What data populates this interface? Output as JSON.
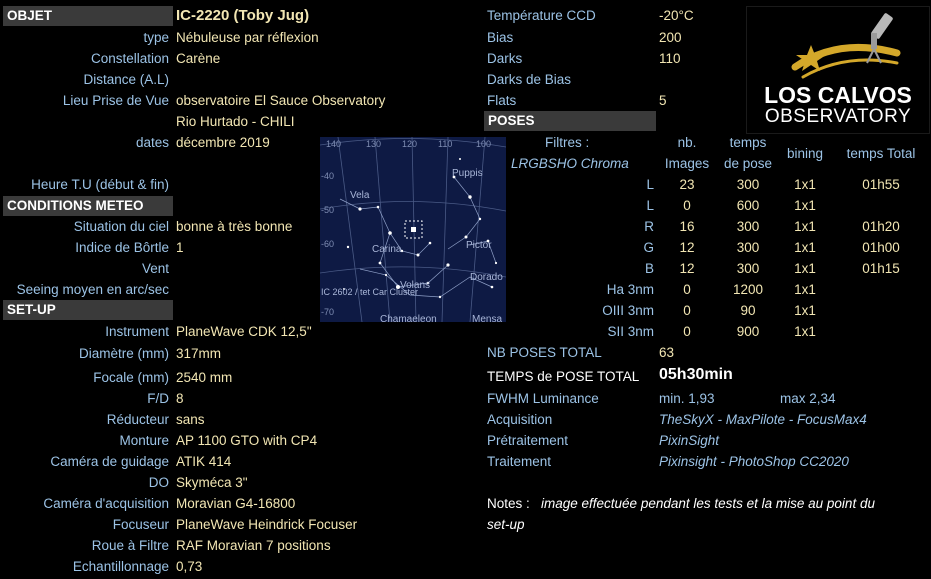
{
  "objet": {
    "header": "OBJET",
    "name": "IC-2220 (Toby Jug)",
    "rows": [
      {
        "label": "type",
        "value": "Nébuleuse par réflexion"
      },
      {
        "label": "Constellation",
        "value": "Carène"
      },
      {
        "label": "Distance (A.L)",
        "value": ""
      },
      {
        "label": "Lieu Prise de Vue",
        "value": "observatoire El Sauce Observatory"
      },
      {
        "label": "",
        "value": "Rio Hurtado - CHILI"
      },
      {
        "label": "dates",
        "value": "décembre 2019"
      },
      {
        "label": "",
        "value": ""
      },
      {
        "label": "Heure T.U (début & fin)",
        "value": ""
      }
    ]
  },
  "meteo": {
    "header": "CONDITIONS METEO",
    "rows": [
      {
        "label": "Situation du ciel",
        "value": "bonne à très bonne"
      },
      {
        "label": "Indice de Bôrtle",
        "value": "1"
      },
      {
        "label": "Vent",
        "value": ""
      },
      {
        "label": "Seeing moyen en arc/sec",
        "value": ""
      }
    ]
  },
  "setup": {
    "header": "SET-UP",
    "rows": [
      {
        "label": "Instrument",
        "value": "PlaneWave CDK 12,5\""
      },
      {
        "label": "Diamètre (mm)",
        "value": "317mm"
      },
      {
        "label": "Focale (mm)",
        "value": "2540 mm"
      },
      {
        "label": "F/D",
        "value": "8"
      },
      {
        "label": "Réducteur",
        "value": "sans"
      },
      {
        "label": "Monture",
        "value": "AP 1100 GTO with CP4"
      },
      {
        "label": "Caméra de guidage",
        "value": "ATIK 414"
      },
      {
        "label": "DO",
        "value": "Skyméca 3\""
      },
      {
        "label": "Caméra d'acquisition",
        "value": "Moravian G4-16800"
      },
      {
        "label": "Focuseur",
        "value": "PlaneWave Heindrick Focuser"
      },
      {
        "label": "Roue à Filtre",
        "value": "RAF Moravian 7 positions"
      },
      {
        "label": "Echantillonnage",
        "value": "0,73"
      }
    ]
  },
  "ccd": [
    {
      "label": "Température CCD",
      "value": "-20°C"
    },
    {
      "label": "Bias",
      "value": "200"
    },
    {
      "label": "Darks",
      "value": "110"
    },
    {
      "label": "Darks de Bias",
      "value": ""
    },
    {
      "label": "Flats",
      "value": "5"
    }
  ],
  "poses": {
    "header": "POSES",
    "filtres_label": "Filtres :",
    "filtres_set": "LRGBSHO Chroma",
    "col_nb": "nb.",
    "col_images": "Images",
    "col_temps": "temps",
    "col_depose": "de pose",
    "col_bining": "bining",
    "col_total": "temps Total",
    "rows": [
      {
        "filter": "L",
        "nb": "23",
        "time": "300",
        "bin": "1x1",
        "total": "01h55"
      },
      {
        "filter": "L",
        "nb": "0",
        "time": "600",
        "bin": "1x1",
        "total": ""
      },
      {
        "filter": "R",
        "nb": "16",
        "time": "300",
        "bin": "1x1",
        "total": "01h20"
      },
      {
        "filter": "G",
        "nb": "12",
        "time": "300",
        "bin": "1x1",
        "total": "01h00"
      },
      {
        "filter": "B",
        "nb": "12",
        "time": "300",
        "bin": "1x1",
        "total": "01h15"
      },
      {
        "filter": "Ha 3nm",
        "nb": "0",
        "time": "1200",
        "bin": "1x1",
        "total": ""
      },
      {
        "filter": "OIII 3nm",
        "nb": "0",
        "time": "90",
        "bin": "1x1",
        "total": ""
      },
      {
        "filter": "SII 3nm",
        "nb": "0",
        "time": "900",
        "bin": "1x1",
        "total": ""
      }
    ]
  },
  "summary": {
    "nb_label": "NB POSES TOTAL",
    "nb_value": "63",
    "temps_label": "TEMPS de POSE TOTAL",
    "temps_value": "05h30min",
    "fwhm_label": "FWHM Luminance",
    "fwhm_min": "min. 1,93",
    "fwhm_max": "max 2,34",
    "acq_label": "Acquisition",
    "acq_value": "TheSkyX - MaxPilote - FocusMax4",
    "pre_label": "Prétraitement",
    "pre_value": "PixinSight",
    "trt_label": "Traitement",
    "trt_value": "Pixinsight - PhotoShop CC2020",
    "notes_label": "Notes :",
    "notes_line1": "image effectuée pendant les tests et la mise au point du",
    "notes_line2": "set-up"
  },
  "logo": {
    "line1": "LOS CALVOS",
    "line2": "OBSERVATORY"
  },
  "starmap": {
    "ra_ticks": [
      "140",
      "130",
      "120",
      "110",
      "100"
    ],
    "dec_ticks": [
      "-40",
      "-50",
      "-60",
      "-70"
    ],
    "labels": [
      "Puppis",
      "Vela",
      "Carina",
      "Pictor",
      "Volans",
      "Dorado",
      "Chamaeleon",
      "Mensa",
      "IC 2602 / tet Car Cluster"
    ]
  },
  "colors": {
    "label": "#9cc3e6",
    "value": "#f2e6b3",
    "header_bg": "#3a3a3a",
    "logo_gold": "#d4a82a"
  }
}
